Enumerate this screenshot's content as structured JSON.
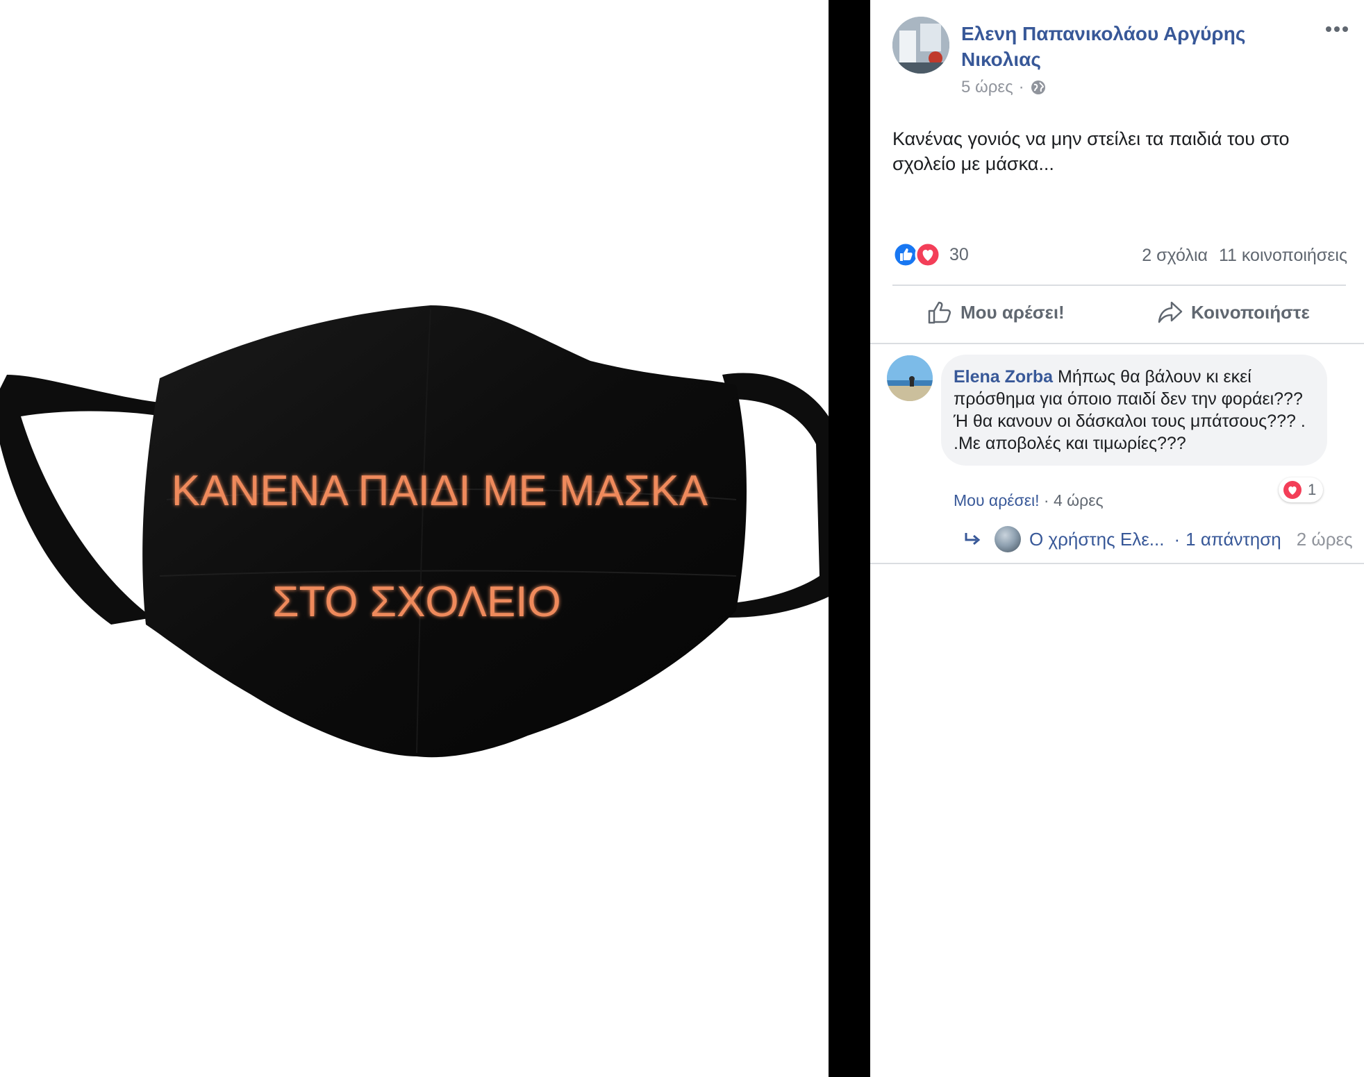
{
  "image": {
    "mask_line1": "ΚΑΝΕΝΑ ΠΑΙΔΙ ΜΕ ΜΑΣΚΑ",
    "mask_line2": "ΣΤΟ ΣΧΟΛΕΙΟ",
    "mask_color": "#0d0d0d",
    "text_color": "#ef8a5c"
  },
  "post": {
    "author": "Ελενη Παπανικολάου Αργύρης Νικολιας",
    "time": "5 ώρες",
    "time_separator": "·",
    "privacy_icon": "globe-icon",
    "more_icon": "more-options-icon",
    "text": "Κανένας γονιός να μην στείλει τα παιδιά του στο σχολείο με μάσκα...",
    "reaction_icons": [
      "like-reaction-icon",
      "love-reaction-icon"
    ],
    "reaction_count": "30",
    "comments_count": "2 σχόλια",
    "shares_count": "11 κοινοποιήσεις",
    "actions": {
      "like_label": "Μου αρέσει!",
      "share_label": "Κοινοποιήστε"
    }
  },
  "comment": {
    "author": "Elena Zorba",
    "text": "Μήπως θα βάλουν κι εκεί πρόσθημα για όποιο παιδί δεν την φοράει??? Ή θα κανουν οι δάσκαλοι τους μπάτσους??? . .Με αποβολές και τιμωρίες???",
    "reaction_count": "1",
    "like_link": "Μου αρέσει!",
    "meta_separator": "·",
    "time": "4 ώρες",
    "reply": {
      "user": "Ο χρήστης Ελε...",
      "separator": "·",
      "replies": "1 απάντηση",
      "time": "2 ώρες"
    }
  },
  "colors": {
    "link_blue": "#385898",
    "secondary_gray": "#606770",
    "divider": "#000000",
    "like_blue": "#1877f2",
    "love_red": "#f33e58"
  }
}
